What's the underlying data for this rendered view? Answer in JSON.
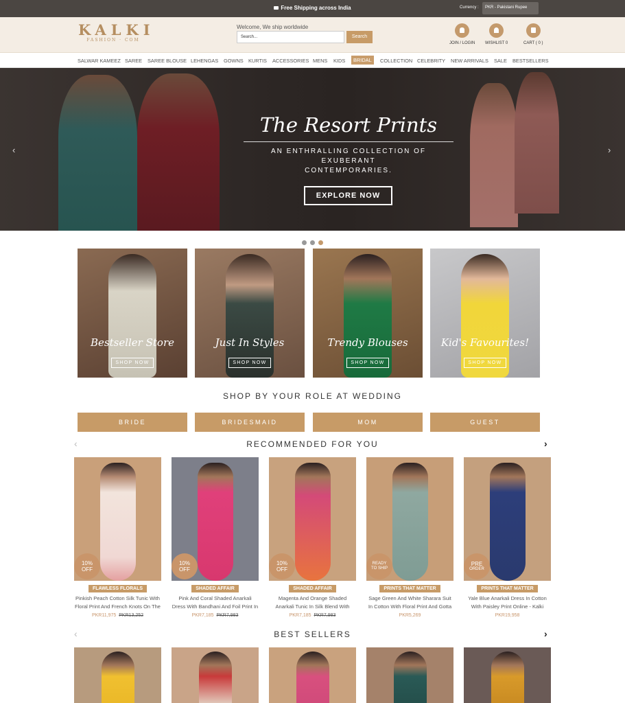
{
  "topbar": {
    "shipping": "Free Shipping across India",
    "currency_label": "Currency :",
    "currency_value": "PKR - Pakistani Rupee"
  },
  "header": {
    "logo_main": "KALKI",
    "logo_sub": "FASHION · COM",
    "welcome": "Welcome, We ship worldwide",
    "search_placeholder": "Search...",
    "search_button": "Search",
    "join_label": "JOIN / LOGIN",
    "wishlist_label": "WISHLIST 0",
    "cart_label": "CART  ( 0 )"
  },
  "nav": [
    "SALWAR KAMEEZ",
    "SAREE",
    "SAREE BLOUSE",
    "LEHENGAS",
    "GOWNS",
    "KURTIS",
    "ACCESSORIES",
    "MENS",
    "KIDS",
    "BRIDAL",
    "COLLECTION",
    "CELEBRITY",
    "NEW ARRIVALS",
    "SALE",
    "BESTSELLERS"
  ],
  "hero": {
    "title": "The Resort Prints",
    "subtitle_line1": "AN ENTHRALLING COLLECTION OF EXUBERANT",
    "subtitle_line2": "CONTEMPORARIES.",
    "button": "EXPLORE NOW",
    "prev_arrow": "‹",
    "next_arrow": "›"
  },
  "categories": [
    {
      "label": "Bestseller Store",
      "cta": "SHOP NOW"
    },
    {
      "label": "Just In Styles",
      "cta": "SHOP NOW"
    },
    {
      "label": "Trendy Blouses",
      "cta": "SHOP NOW"
    },
    {
      "label": "Kid's Favourites!",
      "cta": "SHOP NOW"
    }
  ],
  "roles": {
    "title": "SHOP BY YOUR ROLE AT WEDDING",
    "buttons": [
      "BRIDE",
      "BRIDESMAID",
      "MOM",
      "GUEST"
    ]
  },
  "recommended": {
    "title": "RECOMMENDED FOR YOU",
    "products": [
      {
        "badge1": "10%",
        "badge2": "OFF",
        "tag": "FLAWLESS FLORALS",
        "name": "Pinkish Peach Cotton Silk Tunic With Floral Print And French Knots On The",
        "price": "PKR11,975",
        "old_price": "PKR13,252"
      },
      {
        "badge1": "10%",
        "badge2": "OFF",
        "tag": "SHADED AFFAIR",
        "name": "Pink And Coral Shaded Anarkali Dress With Bandhani And Foil Print In",
        "price": "PKR7,185",
        "old_price": "PKR7,983"
      },
      {
        "badge1": "10%",
        "badge2": "OFF",
        "tag": "SHADED AFFAIR",
        "name": "Magenta And Orange Shaded Anarkali Tunic In Silk Blend With",
        "price": "PKR7,185",
        "old_price": "PKR7,983"
      },
      {
        "badge1": "READY",
        "badge2": "TO SHIP",
        "tag": "PRINTS THAT MATTER",
        "name": "Sage Green And White Sharara Suit In Cotton With Floral Print And Gotta",
        "price": "PKR5,269",
        "old_price": ""
      },
      {
        "badge1": "PRE",
        "badge2": "ORDER",
        "tag": "PRINTS THAT MATTER",
        "name": "Yale Blue Anarkali Dress In Cotton With Paisley Print Online - Kalki",
        "price": "PKR19,958",
        "old_price": ""
      }
    ]
  },
  "bestsellers": {
    "title": "BEST SELLERS"
  },
  "colors": {
    "accent": "#c79b67",
    "topbar": "#4b4642",
    "header_bg": "#f4ede4"
  }
}
